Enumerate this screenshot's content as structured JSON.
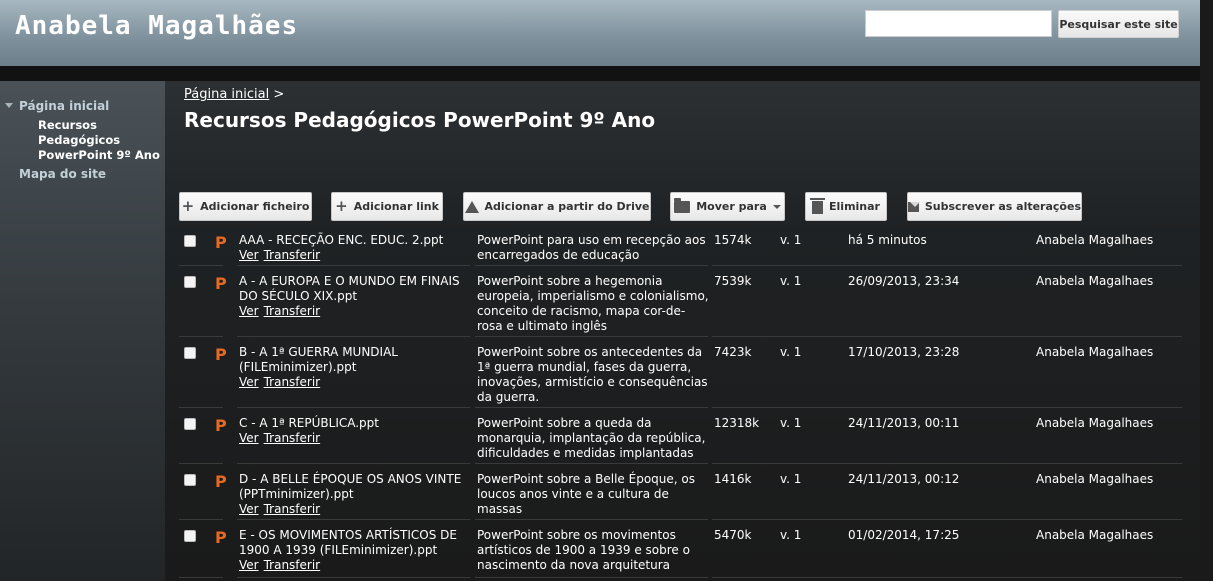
{
  "header": {
    "site_title": "Anabela Magalhães",
    "search_placeholder": "",
    "search_button": "Pesquisar este site"
  },
  "sidebar": {
    "home": "Página inicial",
    "current_page": "Recursos Pedagógicos PowerPoint 9º Ano",
    "sitemap": "Mapa do site"
  },
  "breadcrumb": {
    "home": "Página inicial",
    "separator": ">"
  },
  "page_title": "Recursos Pedagógicos PowerPoint 9º Ano",
  "toolbar": {
    "add_file": "Adicionar ficheiro",
    "add_link": "Adicionar link",
    "add_drive": "Adicionar a partir do Drive",
    "move_to": "Mover para",
    "delete": "Eliminar",
    "subscribe": "Subscrever as alterações"
  },
  "files": [
    {
      "name": "AAA - RECEÇÃO ENC. EDUC. 2.ppt",
      "view": "Ver",
      "download": "Transferir",
      "description": "PowerPoint para uso em recepção aos encarregados de educação",
      "size": "1574k",
      "version": "v. 1",
      "date": "há 5 minutos",
      "author": "Anabela Magalhaes"
    },
    {
      "name": "A - A EUROPA E O MUNDO EM FINAIS DO SÉCULO XIX.ppt",
      "view": "Ver",
      "download": "Transferir",
      "description": "PowerPoint sobre a hegemonia europeia, imperialismo e colonialismo, conceito de racismo, mapa cor-de-rosa e ultimato inglês",
      "size": "7539k",
      "version": "v. 1",
      "date": "26/09/2013, 23:34",
      "author": "Anabela Magalhaes"
    },
    {
      "name": "B - A 1ª GUERRA MUNDIAL (FILEminimizer).ppt",
      "view": "Ver",
      "download": "Transferir",
      "description": "PowerPoint sobre os antecedentes da 1ª guerra mundial, fases da guerra, inovações, armistício e consequências da guerra.",
      "size": "7423k",
      "version": "v. 1",
      "date": "17/10/2013, 23:28",
      "author": "Anabela Magalhaes"
    },
    {
      "name": "C - A 1ª REPÚBLICA.ppt",
      "view": "Ver",
      "download": "Transferir",
      "description": "PowerPoint sobre a queda da monarquia, implantação da república, dificuldades e medidas implantadas",
      "size": "12318k",
      "version": "v. 1",
      "date": "24/11/2013, 00:11",
      "author": "Anabela Magalhaes"
    },
    {
      "name": "D - A BELLE ÉPOQUE OS ANOS VINTE (PPTminimizer).ppt",
      "view": "Ver",
      "download": "Transferir",
      "description": "PowerPoint sobre a Belle Époque, os loucos anos vinte e a cultura de massas",
      "size": "1416k",
      "version": "v. 1",
      "date": "24/11/2013, 00:12",
      "author": "Anabela Magalhaes"
    },
    {
      "name": "E - OS MOVIMENTOS ARTÍSTICOS DE 1900 A 1939 (FILEminimizer).ppt",
      "view": "Ver",
      "download": "Transferir",
      "description": "PowerPoint sobre os movimentos artísticos de 1900 a 1939 e sobre o nascimento da nova arquitetura",
      "size": "5470k",
      "version": "v. 1",
      "date": "01/02/2014, 17:25",
      "author": "Anabela Magalhaes"
    }
  ]
}
